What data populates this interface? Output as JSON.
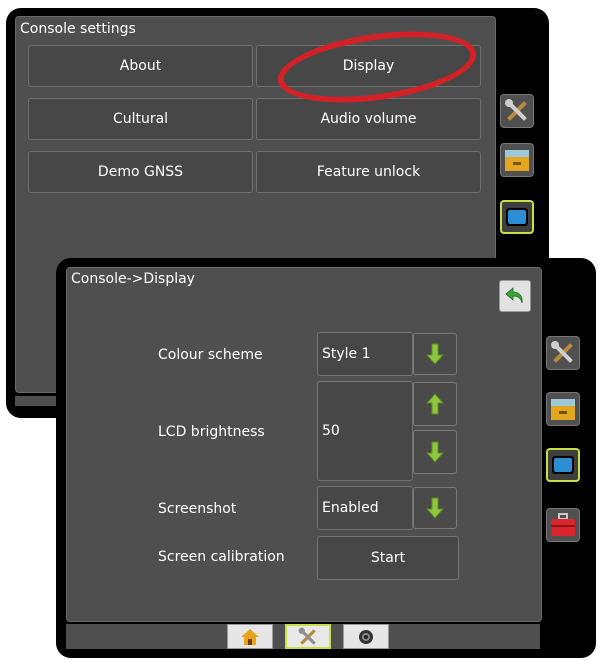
{
  "console_settings": {
    "title": "Console settings",
    "buttons": [
      {
        "label": "About"
      },
      {
        "label": "Display"
      },
      {
        "label": "Cultural"
      },
      {
        "label": "Audio volume"
      },
      {
        "label": "Demo GNSS"
      },
      {
        "label": "Feature unlock"
      }
    ]
  },
  "display": {
    "title": "Console->Display",
    "colour_scheme_label": "Colour scheme",
    "colour_scheme_value": "Style 1",
    "lcd_brightness_label": "LCD brightness",
    "lcd_brightness_value": "50",
    "screenshot_label": "Screenshot",
    "screenshot_value": "Enabled",
    "screen_calibration_label": "Screen calibration",
    "start_label": "Start"
  },
  "icons": {
    "back": "back-arrow-icon",
    "tools": "tools-icon",
    "console": "console-drawer-icon",
    "monitor": "monitor-icon",
    "toolbox": "toolbox-icon",
    "home": "home-icon",
    "camera": "camera-icon"
  },
  "colors": {
    "accent": "#c7e043",
    "highlight": "#d42128",
    "arrow": "#8dc63f"
  }
}
